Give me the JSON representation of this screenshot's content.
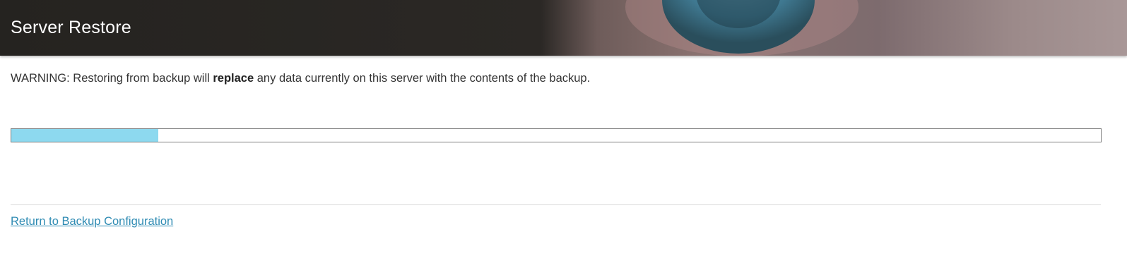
{
  "header": {
    "title": "Server Restore"
  },
  "warning": {
    "prefix": "WARNING: Restoring from backup will ",
    "emphasis": "replace",
    "suffix": " any data currently on this server with the contents of the backup."
  },
  "progress": {
    "fraction": 0.135
  },
  "footer": {
    "return_link": "Return to Backup Configuration"
  },
  "colors": {
    "header_bg": "#252320",
    "progress_fill": "#8dd9ef",
    "link": "#2e8bb3"
  }
}
